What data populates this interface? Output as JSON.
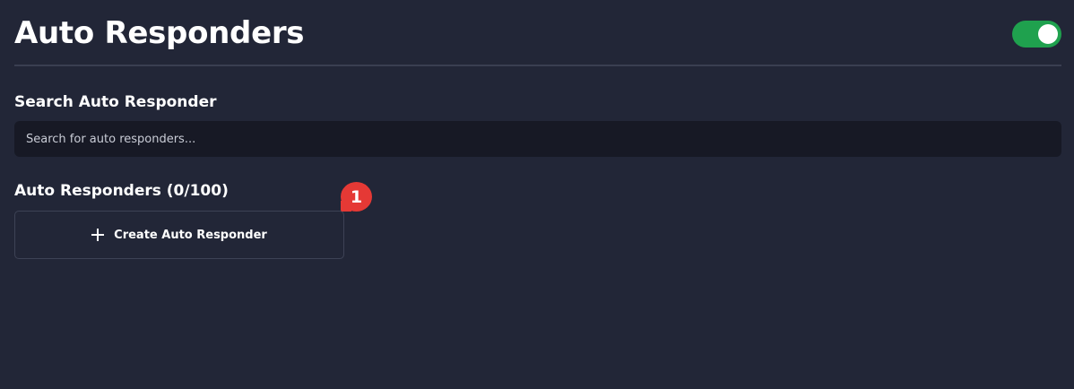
{
  "header": {
    "title": "Auto Responders",
    "toggle_on": true
  },
  "search": {
    "label": "Search Auto Responder",
    "placeholder": "Search for auto responders...",
    "value": ""
  },
  "list": {
    "title": "Auto Responders (0/100)",
    "create_label": "Create Auto Responder",
    "create_icon": "plus-icon"
  },
  "badge": {
    "count": "1"
  },
  "colors": {
    "background": "#222637",
    "input_background": "#171925",
    "toggle_on": "#1fa14e",
    "badge": "#e53935"
  }
}
